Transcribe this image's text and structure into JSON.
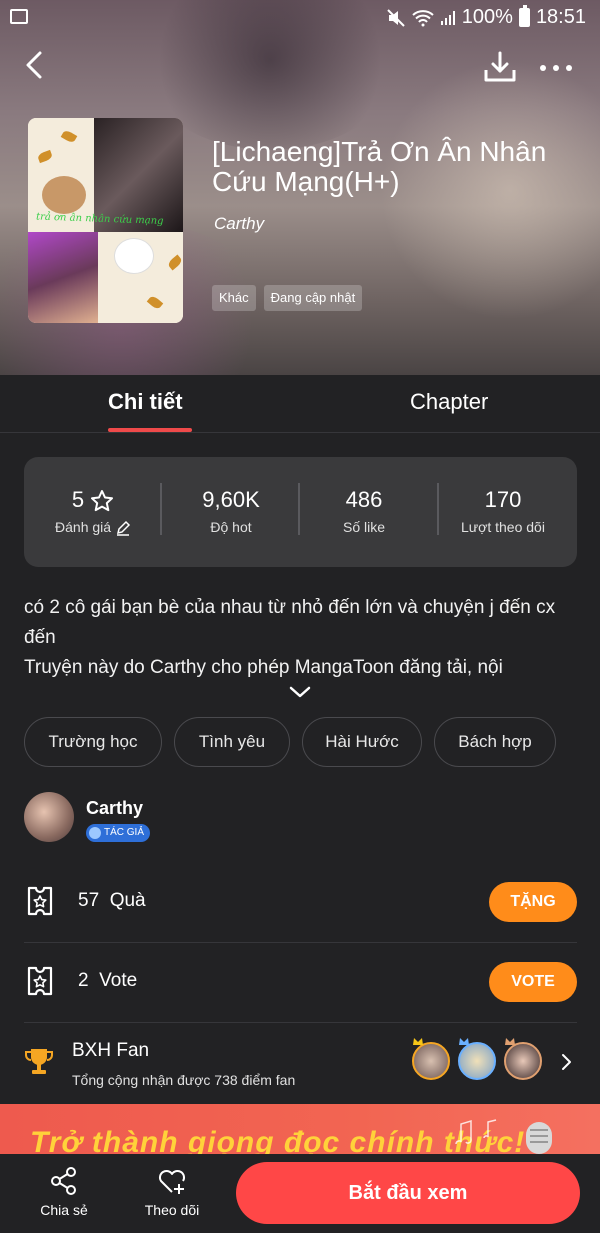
{
  "status_bar": {
    "battery": "100%",
    "time": "18:51"
  },
  "comic": {
    "title": "[Lichaeng]Trả Ơn Ân Nhân Cứu Mạng(H+)",
    "author": "Carthy",
    "cover_caption": "trả ơn ân nhân cứu mạng",
    "tags": [
      "Khác",
      "Đang cập nhật"
    ]
  },
  "tabs": [
    {
      "label": "Chi tiết",
      "active": true
    },
    {
      "label": "Chapter",
      "active": false
    }
  ],
  "stats": [
    {
      "value": "5",
      "label": "Đánh giá"
    },
    {
      "value": "9,60K",
      "label": "Độ hot"
    },
    {
      "value": "486",
      "label": "Số like"
    },
    {
      "value": "170",
      "label": "Lượt theo dõi"
    }
  ],
  "description": {
    "line1": "có 2 cô gái bạn bè của nhau từ nhỏ đến lớn và chuyện j đến cx đến",
    "line2": "Truyện này do Carthy cho phép MangaToon đăng tải, nội"
  },
  "genres": [
    "Trường học",
    "Tình yêu",
    "Hài Hước",
    "Bách hợp"
  ],
  "author_section": {
    "name": "Carthy",
    "badge": "TÁC GIẢ"
  },
  "gifts": {
    "count": "57",
    "label": "Quà",
    "button": "TẶNG"
  },
  "votes": {
    "count": "2",
    "label": "Vote",
    "button": "VOTE"
  },
  "fan_ranking": {
    "title": "BXH Fan",
    "subtitle": "Tổng cộng nhận được 738 điểm fan"
  },
  "promo": {
    "text": "Trở thành giọng đọc chính thức!"
  },
  "bottom_bar": {
    "share": "Chia sẻ",
    "follow": "Theo dõi",
    "start": "Bắt đầu xem"
  },
  "colors": {
    "accent_red": "#ff4747",
    "accent_orange": "#ff8c1a",
    "background": "#222224",
    "card": "#3a3a3c"
  }
}
